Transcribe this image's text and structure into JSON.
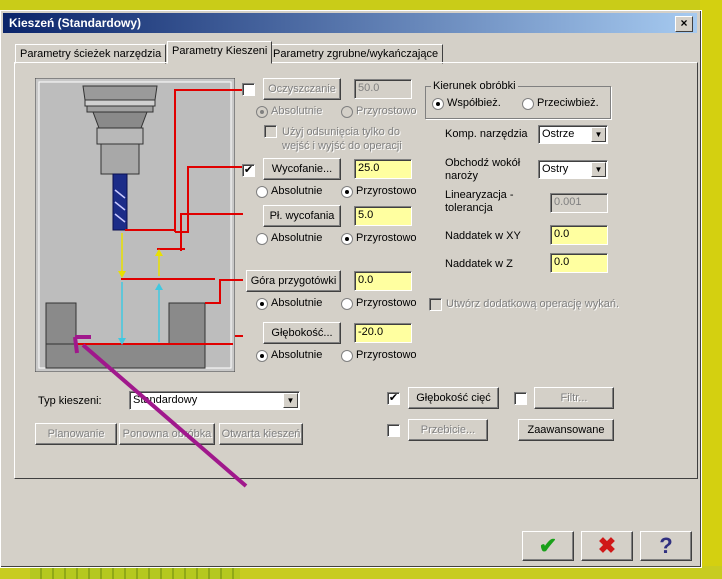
{
  "window": {
    "title": "Kieszeń (Standardowy)",
    "close": "×"
  },
  "tabs": [
    "Parametry ścieżek narzędzia",
    "Parametry Kieszeni",
    "Parametry zgrubne/wykańczające"
  ],
  "clearance": {
    "label": "Oczyszczanie",
    "value": "50.0",
    "absolute": "Absolutnie",
    "incremental": "Przyrostowo",
    "offset_option": "Użyj odsunięcia tylko do wejść i wyjść do operacji",
    "checked": false
  },
  "retract": {
    "label": "Wycofanie...",
    "value": "25.0",
    "absolute": "Absolutnie",
    "incremental": "Przyrostowo",
    "checked": true
  },
  "feed_plane": {
    "label": "Pł. wycofania",
    "value": "5.0",
    "absolute": "Absolutnie",
    "incremental": "Przyrostowo"
  },
  "top_stock": {
    "label": "Góra przygotówki",
    "value": "0.0",
    "absolute": "Absolutnie",
    "incremental": "Przyrostowo"
  },
  "depth": {
    "label": "Głębokość...",
    "value": "-20.0",
    "absolute": "Absolutnie",
    "incremental": "Przyrostowo"
  },
  "machining_direction": {
    "title": "Kierunek obróbki",
    "climb": "Współbież.",
    "conventional": "Przeciwbież."
  },
  "tip_comp": {
    "label": "Komp. narzędzia",
    "value": "Ostrze"
  },
  "roll_cutter": {
    "label": "Obchodź wokół naroży",
    "value": "Ostry"
  },
  "linearization": {
    "label": "Linearyzacja - tolerancja",
    "value": "0.001"
  },
  "stock_xy": {
    "label": "Naddatek w XY",
    "value": "0.0"
  },
  "stock_z": {
    "label": "Naddatek w Z",
    "value": "0.0"
  },
  "extra_finish": {
    "label": "Utwórz dodatkową operację wykań."
  },
  "pocket_type": {
    "label": "Typ kieszeni:",
    "value": "Standardowy"
  },
  "pocket_buttons": [
    "Planowanie",
    "Ponowna obróbka",
    "Otwarta kieszeń"
  ],
  "depth_cuts": {
    "label": "Głębokość cięć",
    "checked": true
  },
  "filter": {
    "label": "Filtr...",
    "checked": false
  },
  "breakthrough": {
    "label": "Przebicie...",
    "checked": false
  },
  "advanced": {
    "label": "Zaawansowane"
  },
  "bottom_buttons": {
    "ok": "✔",
    "cancel": "✖",
    "help": "?"
  },
  "colors": {
    "title_start": "#0a246a",
    "field_bg": "#ffffa0",
    "guide_red": "#e00000",
    "arrow_purple": "#a0188c"
  }
}
